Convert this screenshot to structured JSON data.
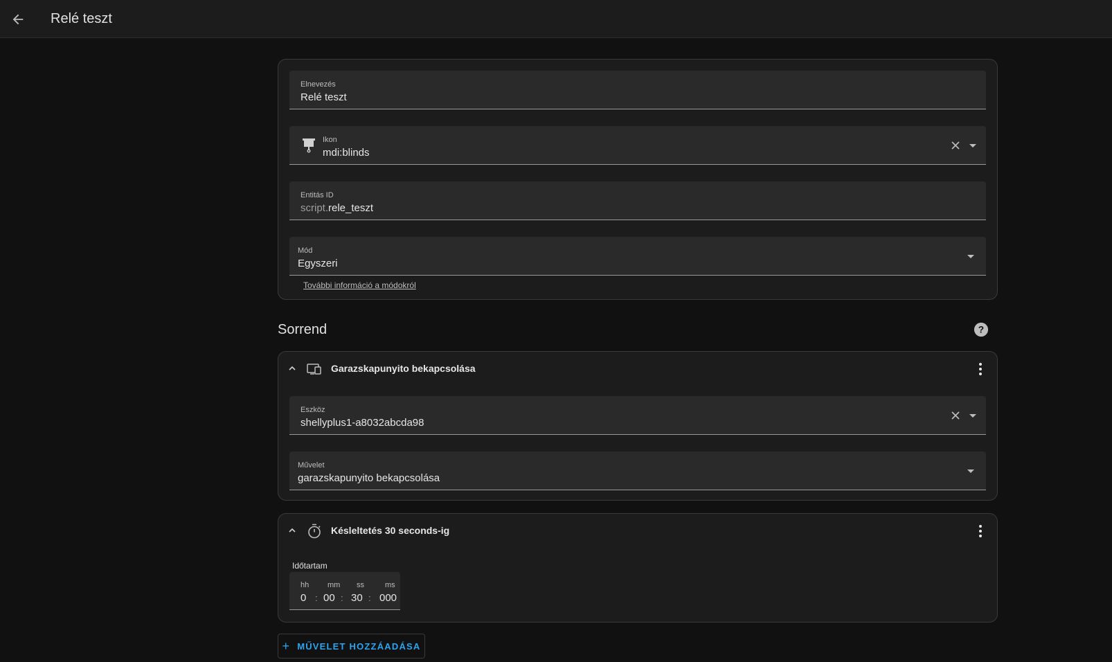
{
  "header": {
    "title": "Relé teszt"
  },
  "script_form": {
    "name": {
      "label": "Elnevezés",
      "value": "Relé teszt"
    },
    "icon": {
      "label": "Ikon",
      "value": "mdi:blinds"
    },
    "entity_id": {
      "label": "Entitás ID",
      "prefix": "script.",
      "value": "rele_teszt"
    },
    "mode": {
      "label": "Mód",
      "value": "Egyszeri",
      "link": "További információ a módokról"
    }
  },
  "sequence": {
    "title": "Sorrend",
    "actions": [
      {
        "title": "Garazskapunyito bekapcsolása",
        "device": {
          "label": "Eszköz",
          "value": "shellyplus1-a8032abcda98"
        },
        "action": {
          "label": "Művelet",
          "value": "garazskapunyito bekapcsolása"
        }
      },
      {
        "title": "Késleltetés 30 seconds-ig",
        "duration": {
          "label": "Időtartam",
          "units": {
            "hh": "hh",
            "mm": "mm",
            "ss": "ss",
            "ms": "ms"
          },
          "values": {
            "hh": "0",
            "mm": "00",
            "ss": "30",
            "ms": "000"
          },
          "separator": ":"
        }
      }
    ],
    "add_button": "MŰVELET HOZZÁADÁSA"
  },
  "colors": {
    "accent": "#2da4f0",
    "background": "#111111",
    "card": "#1c1c1c"
  }
}
